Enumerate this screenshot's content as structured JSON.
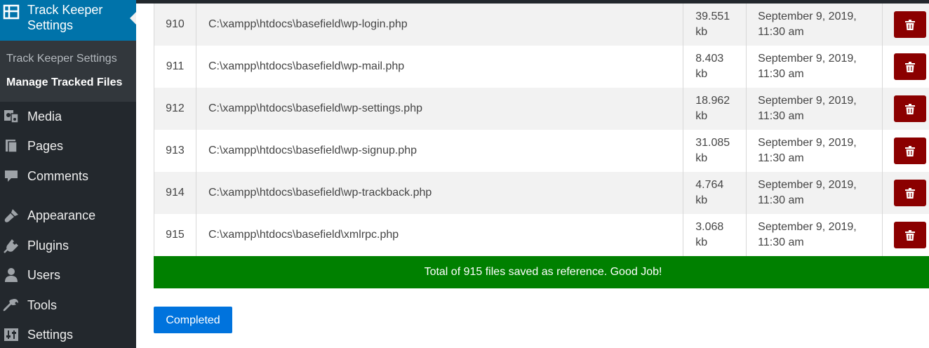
{
  "sidebar": {
    "active_menu": {
      "label_line1": "Track Keeper",
      "label_line2": "Settings",
      "icon": "table-icon"
    },
    "submenu": [
      {
        "label": "Track Keeper Settings",
        "current": false
      },
      {
        "label": "Manage Tracked Files",
        "current": true
      }
    ],
    "items": [
      {
        "label": "Media",
        "icon": "media-icon"
      },
      {
        "label": "Pages",
        "icon": "pages-icon"
      },
      {
        "label": "Comments",
        "icon": "comments-icon"
      },
      {
        "label": "Appearance",
        "icon": "appearance-icon"
      },
      {
        "label": "Plugins",
        "icon": "plugins-icon"
      },
      {
        "label": "Users",
        "icon": "users-icon"
      },
      {
        "label": "Tools",
        "icon": "tools-icon"
      },
      {
        "label": "Settings",
        "icon": "settings-icon"
      }
    ]
  },
  "files": [
    {
      "id": "910",
      "path": "C:\\xampp\\htdocs\\basefield\\wp-login.php",
      "size_value": "39.551",
      "size_unit": "kb",
      "date": "September 9, 2019,",
      "time": "11:30 am"
    },
    {
      "id": "911",
      "path": "C:\\xampp\\htdocs\\basefield\\wp-mail.php",
      "size_value": "8.403",
      "size_unit": "kb",
      "date": "September 9, 2019,",
      "time": "11:30 am"
    },
    {
      "id": "912",
      "path": "C:\\xampp\\htdocs\\basefield\\wp-settings.php",
      "size_value": "18.962",
      "size_unit": "kb",
      "date": "September 9, 2019,",
      "time": "11:30 am"
    },
    {
      "id": "913",
      "path": "C:\\xampp\\htdocs\\basefield\\wp-signup.php",
      "size_value": "31.085",
      "size_unit": "kb",
      "date": "September 9, 2019,",
      "time": "11:30 am"
    },
    {
      "id": "914",
      "path": "C:\\xampp\\htdocs\\basefield\\wp-trackback.php",
      "size_value": "4.764",
      "size_unit": "kb",
      "date": "September 9, 2019,",
      "time": "11:30 am"
    },
    {
      "id": "915",
      "path": "C:\\xampp\\htdocs\\basefield\\xmlrpc.php",
      "size_value": "3.068",
      "size_unit": "kb",
      "date": "September 9, 2019,",
      "time": "11:30 am"
    }
  ],
  "success_message": "Total of 915 files saved as reference. Good Job!",
  "completed_button": "Completed",
  "colors": {
    "sidebar_bg": "#23282d",
    "active_menu": "#0073aa",
    "success": "#008000",
    "delete": "#8b0000",
    "primary_button": "#0073dd"
  }
}
